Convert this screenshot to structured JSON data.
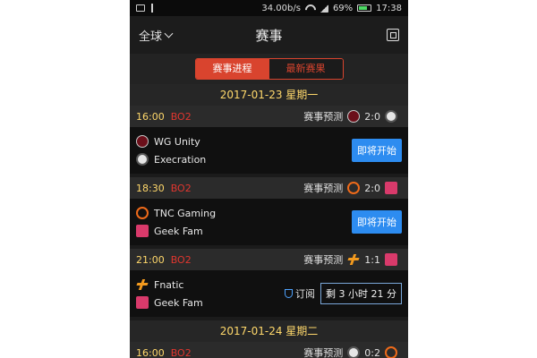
{
  "status_bar": {
    "speed": "34.00b/s",
    "battery": "69%",
    "time": "17:38"
  },
  "header": {
    "region": "全球",
    "title": "赛事"
  },
  "tabs": [
    {
      "label": "赛事进程",
      "active": true
    },
    {
      "label": "最新赛果",
      "active": false
    }
  ],
  "colors": {
    "accent": "#d9442e",
    "gold": "#ffd86b",
    "blue": "#2d8cf0"
  },
  "days": [
    {
      "date": "2017-01-23 星期一",
      "matches": [
        {
          "time": "16:00",
          "format": "BO2",
          "prediction": "赛事预测",
          "score": "2:0",
          "team1": {
            "name": "WG Unity",
            "logo": "wg-unity-logo"
          },
          "team2": {
            "name": "Execration",
            "logo": "execration-logo"
          },
          "action": "即将开始"
        },
        {
          "time": "18:30",
          "format": "BO2",
          "prediction": "赛事预测",
          "score": "2:0",
          "team1": {
            "name": "TNC Gaming",
            "logo": "tnc-logo"
          },
          "team2": {
            "name": "Geek Fam",
            "logo": "geek-fam-logo"
          },
          "action": "即将开始"
        },
        {
          "time": "21:00",
          "format": "BO2",
          "prediction": "赛事预测",
          "score": "1:1",
          "team1": {
            "name": "Fnatic",
            "logo": "fnatic-logo"
          },
          "team2": {
            "name": "Geek Fam",
            "logo": "geek-fam-logo"
          },
          "subscribe": "订阅",
          "countdown": "剩 3 小时 21 分"
        }
      ]
    },
    {
      "date": "2017-01-24 星期二",
      "matches": [
        {
          "time": "16:00",
          "format": "BO2",
          "prediction": "赛事预测",
          "score": "0:2"
        }
      ]
    }
  ]
}
